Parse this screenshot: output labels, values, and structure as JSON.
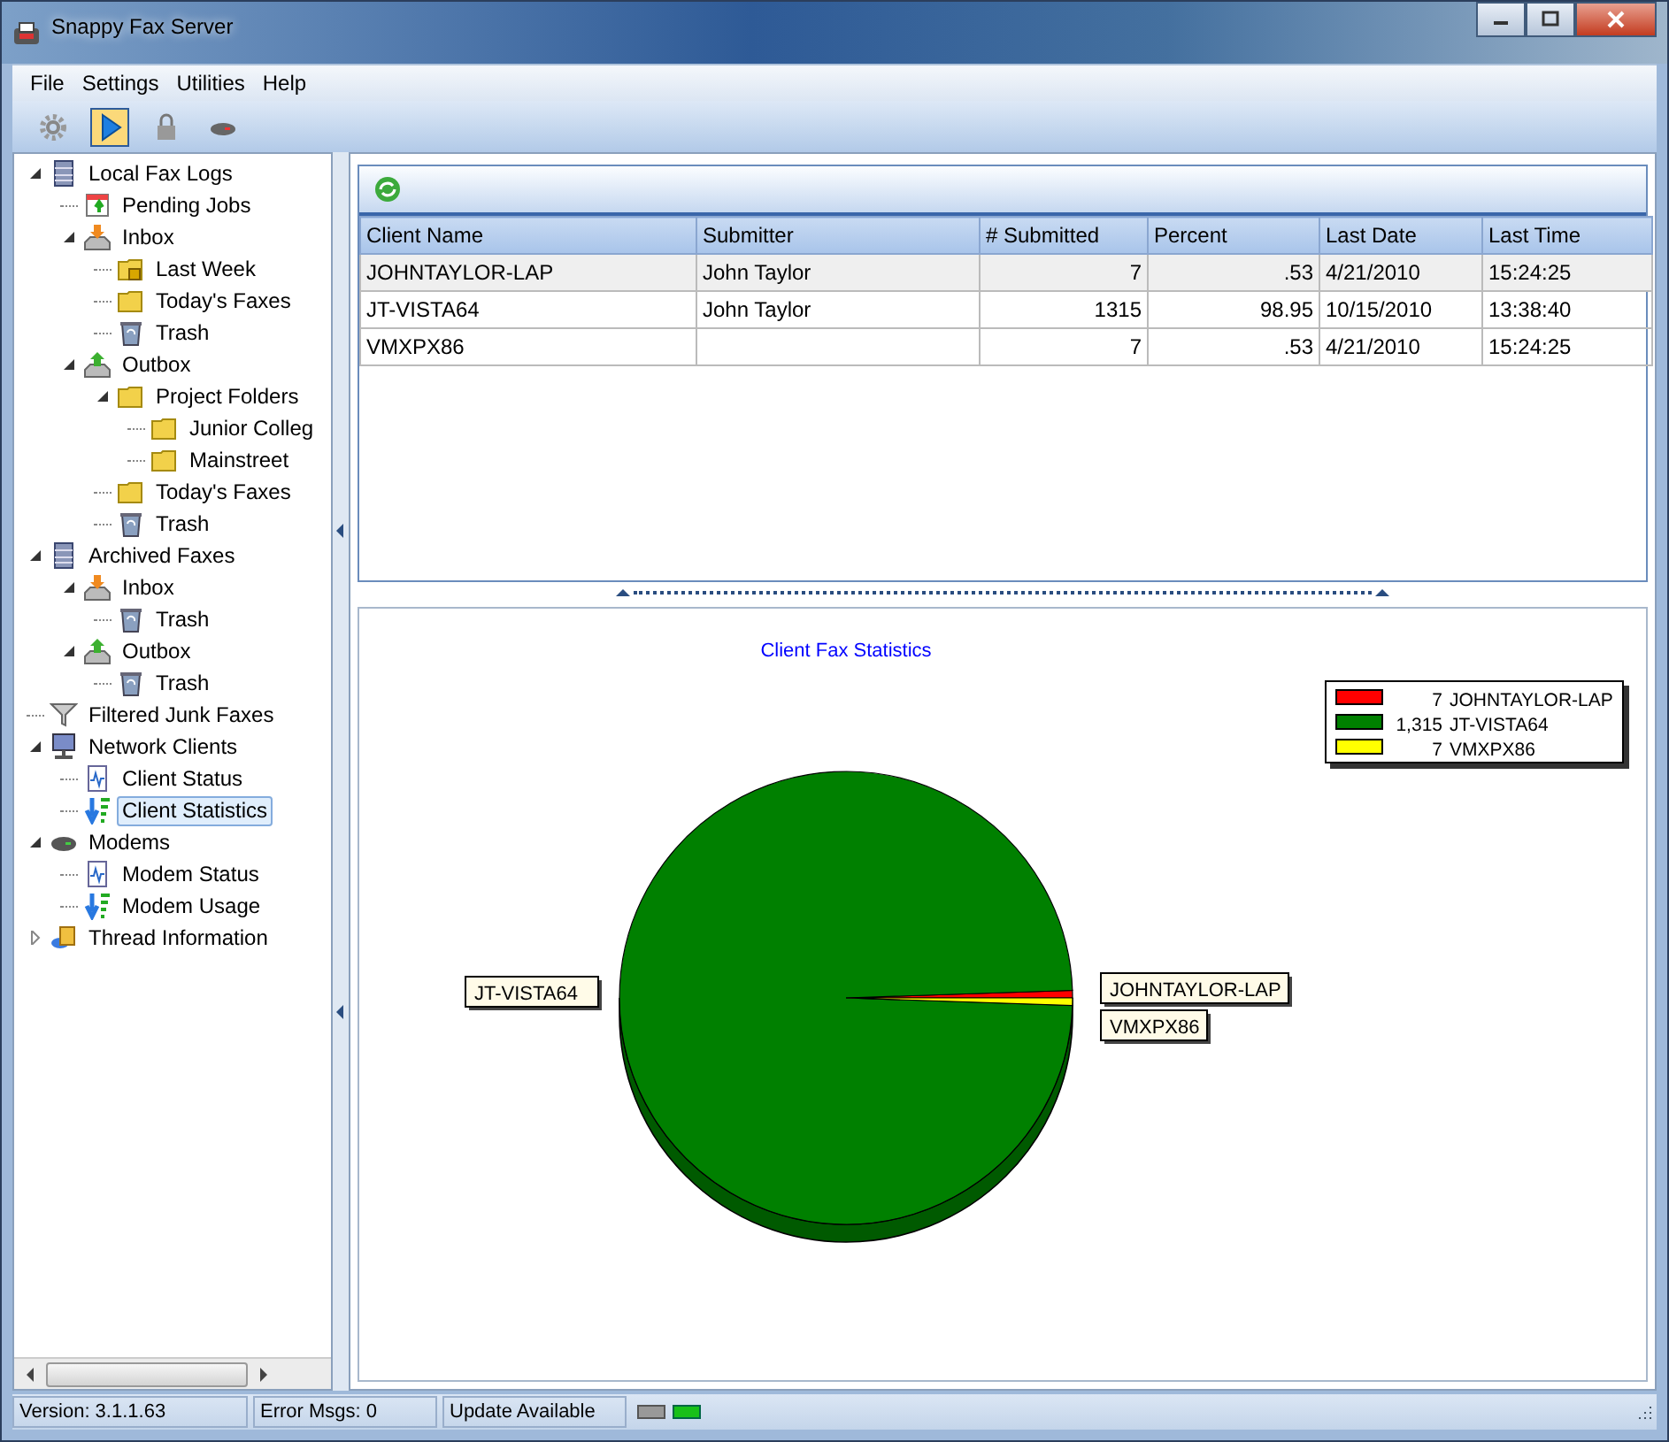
{
  "window": {
    "title": "Snappy Fax Server"
  },
  "menu": [
    "File",
    "Settings",
    "Utilities",
    "Help"
  ],
  "toolbar": [
    {
      "kind": "gear",
      "selected": false
    },
    {
      "kind": "play",
      "selected": true
    },
    {
      "kind": "lock",
      "selected": false
    },
    {
      "kind": "modem",
      "selected": false
    }
  ],
  "tree": [
    {
      "label": "Local Fax Logs",
      "kind": "db",
      "expanded": true,
      "selected": false,
      "children": [
        {
          "label": "Pending Jobs",
          "kind": "pending",
          "selected": false
        },
        {
          "label": "Inbox",
          "kind": "inbox",
          "expanded": true,
          "selected": false,
          "children": [
            {
              "label": "Last Week",
              "kind": "folderlock",
              "selected": false
            },
            {
              "label": "Today's Faxes",
              "kind": "folder",
              "selected": false
            },
            {
              "label": "Trash",
              "kind": "trash",
              "selected": false
            }
          ]
        },
        {
          "label": "Outbox",
          "kind": "outbox",
          "expanded": true,
          "selected": false,
          "children": [
            {
              "label": "Project Folders",
              "kind": "folder",
              "expanded": true,
              "selected": false,
              "children": [
                {
                  "label": "Junior Colleg",
                  "kind": "folder",
                  "selected": false
                },
                {
                  "label": "Mainstreet",
                  "kind": "folder",
                  "selected": false
                }
              ]
            },
            {
              "label": "Today's Faxes",
              "kind": "folder",
              "selected": false
            },
            {
              "label": "Trash",
              "kind": "trash",
              "selected": false
            }
          ]
        }
      ]
    },
    {
      "label": "Archived Faxes",
      "kind": "db",
      "expanded": true,
      "selected": false,
      "children": [
        {
          "label": "Inbox",
          "kind": "inbox",
          "expanded": true,
          "selected": false,
          "children": [
            {
              "label": "Trash",
              "kind": "trash",
              "selected": false
            }
          ]
        },
        {
          "label": "Outbox",
          "kind": "outbox",
          "expanded": true,
          "selected": false,
          "children": [
            {
              "label": "Trash",
              "kind": "trash",
              "selected": false
            }
          ]
        }
      ]
    },
    {
      "label": "Filtered Junk Faxes",
      "kind": "filter",
      "selected": false
    },
    {
      "label": "Network Clients",
      "kind": "network",
      "expanded": true,
      "selected": false,
      "children": [
        {
          "label": "Client Status",
          "kind": "status",
          "selected": false
        },
        {
          "label": "Client Statistics",
          "kind": "stats",
          "selected": true
        }
      ]
    },
    {
      "label": "Modems",
      "kind": "modem",
      "expanded": true,
      "selected": false,
      "children": [
        {
          "label": "Modem  Status",
          "kind": "status",
          "selected": false
        },
        {
          "label": "Modem  Usage",
          "kind": "stats",
          "selected": false
        }
      ]
    },
    {
      "label": "Thread Information",
      "kind": "thread",
      "expanded": false,
      "selected": false
    }
  ],
  "table": {
    "columns": [
      "Client Name",
      "Submitter",
      "# Submitted",
      "Percent",
      "Last Date",
      "Last Time"
    ],
    "rows": [
      {
        "selected": true,
        "cells": [
          "JOHNTAYLOR-LAP",
          "John Taylor",
          "7",
          ".53",
          "4/21/2010",
          "15:24:25"
        ]
      },
      {
        "selected": false,
        "cells": [
          "JT-VISTA64",
          "John Taylor",
          "1315",
          "98.95",
          "10/15/2010",
          "13:38:40"
        ]
      },
      {
        "selected": false,
        "cells": [
          "VMXPX86",
          "",
          "7",
          ".53",
          "4/21/2010",
          "15:24:25"
        ]
      }
    ]
  },
  "chart": {
    "legend": [
      {
        "count": "7",
        "label": "JOHNTAYLOR-LAP",
        "color": "#ff0000"
      },
      {
        "count": "1,315",
        "label": "JT-VISTA64",
        "color": "#008000"
      },
      {
        "count": "7",
        "label": "VMXPX86",
        "color": "#ffff00"
      }
    ],
    "chart_data": {
      "type": "pie",
      "title": "Client Fax Statistics",
      "categories": [
        "JOHNTAYLOR-LAP",
        "JT-VISTA64",
        "VMXPX86"
      ],
      "values": [
        0.53,
        98.95,
        0.53
      ]
    }
  },
  "status_bar": [
    "Version: 3.1.1.63",
    "Error Msgs: 0",
    "Update Available"
  ]
}
